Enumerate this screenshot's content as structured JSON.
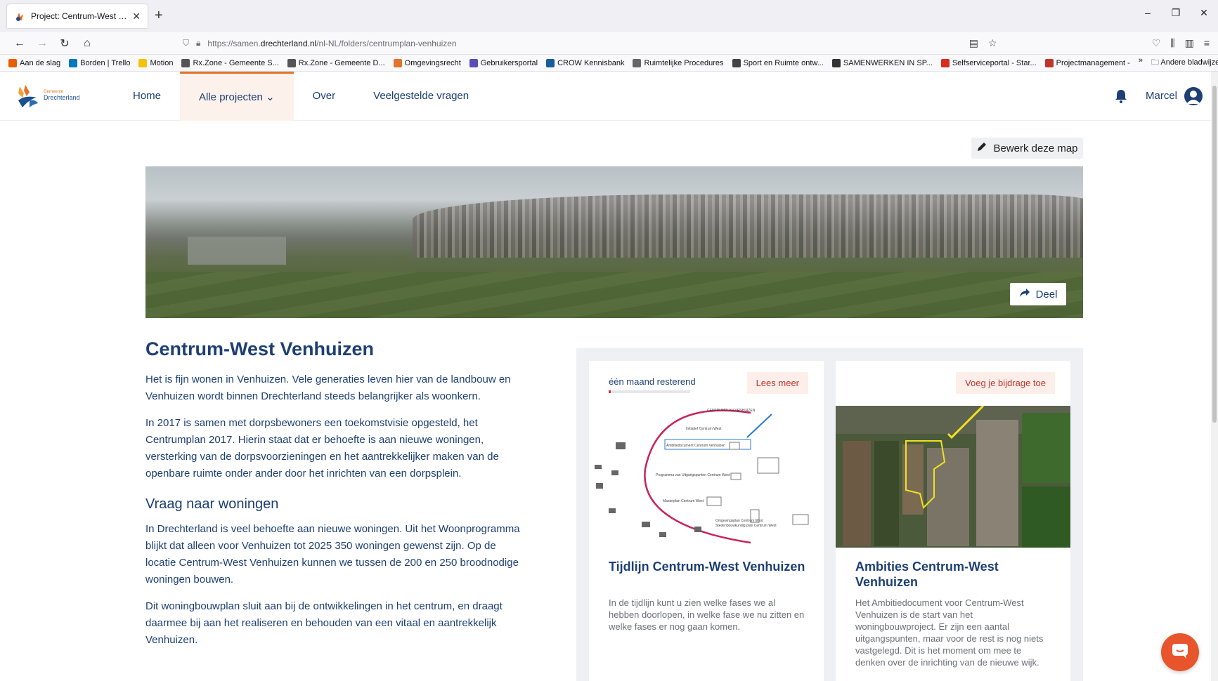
{
  "browser": {
    "tab_title": "Project: Centrum-West Venhuiz",
    "tab_close": "✕",
    "new_tab": "+",
    "url_prefix": "https://samen.",
    "url_domain": "drechterland.nl",
    "url_path": "/nl-NL/folders/centrumplan-venhuizen",
    "bookmarks": [
      {
        "label": "Aan de slag",
        "color": "#e66000"
      },
      {
        "label": "Borden | Trello",
        "color": "#0079bf"
      },
      {
        "label": "Motion",
        "color": "#f4c20d"
      },
      {
        "label": "Rx.Zone - Gemeente S...",
        "color": "#555555"
      },
      {
        "label": "Rx.Zone - Gemeente D...",
        "color": "#555555"
      },
      {
        "label": "Omgevingsrecht",
        "color": "#e2732d"
      },
      {
        "label": "Gebruikersportal",
        "color": "#5b4bb7"
      },
      {
        "label": "CROW Kennisbank",
        "color": "#1a5c9e"
      },
      {
        "label": "Ruimtelijke Procedures",
        "color": "#666666"
      },
      {
        "label": "Sport en Ruimte ontw...",
        "color": "#444444"
      },
      {
        "label": "SAMENWERKEN IN SP...",
        "color": "#333333"
      },
      {
        "label": "Selfserviceportal - Star...",
        "color": "#d62d20"
      },
      {
        "label": "Projectmanagement -",
        "color": "#c0352b"
      }
    ],
    "bookmarks_more": "»",
    "other_bookmarks": "Andere bladwijzers"
  },
  "header": {
    "logo_small": "Gemeente",
    "logo_name": "Drechterland",
    "nav": [
      {
        "label": "Home",
        "active": false
      },
      {
        "label": "Alle projecten ⌄",
        "active": true
      },
      {
        "label": "Over",
        "active": false
      },
      {
        "label": "Veelgestelde vragen",
        "active": false
      }
    ],
    "user_name": "Marcel"
  },
  "actions": {
    "edit_label": "Bewerk deze map",
    "share_label": "Deel"
  },
  "article": {
    "title": "Centrum-West Venhuizen",
    "p1": "Het is fijn wonen in Venhuizen. Vele generaties leven hier van de landbouw en Venhuizen wordt binnen Drechterland steeds belangrijker als woonkern.",
    "p2": "In 2017 is samen met dorpsbewoners een toekomstvisie opgesteld, het Centrumplan 2017. Hierin staat dat er behoefte is aan nieuwe woningen, versterking van de dorpsvoorzieningen en het aantrekkelijker maken van de openbare ruimte onder ander door het inrichten van een dorpsplein.",
    "h2": "Vraag naar woningen",
    "p3": "In Drechterland is veel behoefte aan nieuwe woningen. Uit het Woonprogramma blijkt dat alleen voor Venhuizen tot 2025 350 woningen gewenst zijn. Op de locatie Centrum-West Venhuizen kunnen we tussen de 200 en 250 broodnodige woningen bouwen.",
    "p4": "Dit woningbouwplan sluit aan bij de ontwikkelingen in het centrum, en draagt daarmee bij aan het realiseren en behouden van een vitaal en aantrekkelijk Venhuizen."
  },
  "cards": [
    {
      "status": "één maand resterend",
      "progress": 0.03,
      "badge": "Lees meer",
      "title": "Tijdlijn Centrum-West Venhuizen",
      "desc": "In de tijdlijn kunt u zien welke fases we al hebben doorlopen, in welke fase we nu zitten en welke fases er nog gaan komen."
    },
    {
      "badge": "Voeg je bijdrage toe",
      "title": "Ambities Centrum-West Venhuizen",
      "desc": "Het Ambitiedocument voor Centrum-West Venhuizen is de start van het woningbouwproject. Er zijn een aantal uitgangspunten, maar voor de rest is nog niets vastgelegd. Dit is het moment om mee te denken over de inrichting van de nieuwe wijk."
    }
  ],
  "timeline_labels": [
    "CENTRUMPLAN VENHUIZEN",
    "Initiatief Centrum West",
    "Ambitiedocument Centrum Venhuizen",
    "Programma van Uitgangspunten Centrum West",
    "Masterplan Centrum West",
    "Omgevingsplan Centrum West",
    "Stedenbouwkundig plan Centrum West"
  ],
  "colors": {
    "primary": "#1d3f73",
    "accent": "#e2732d",
    "badge_text": "#c0352b",
    "chat": "#e8542b"
  }
}
